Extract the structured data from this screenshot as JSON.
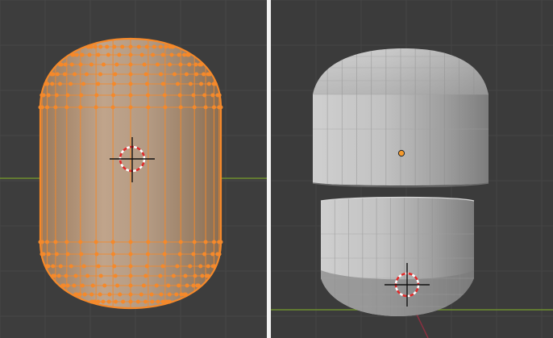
{
  "screenshot": {
    "layout": "split-comparison",
    "background_color": "#3d3d3d",
    "divider_color": "#f2f2f2"
  },
  "left_viewport": {
    "mode": "edit-mode-mesh",
    "object": "capsule-mesh",
    "selection": "all-vertices-selected",
    "selection_color": "#f5892a",
    "grid_line_color": "#474747",
    "x_axis_color": "#6e8f2f",
    "icons": [
      "3d-cursor-icon"
    ]
  },
  "right_viewport": {
    "mode": "object-mode-solid",
    "object": "capsule-separated-halves",
    "shading_color": "#b3b3b3",
    "origin_color": "#f59a2c",
    "grid_line_color": "#454545",
    "x_axis_color": "#6e8f2f",
    "y_axis_color": "#8a3040",
    "icons": [
      "origin-point-icon",
      "3d-cursor-icon"
    ]
  }
}
